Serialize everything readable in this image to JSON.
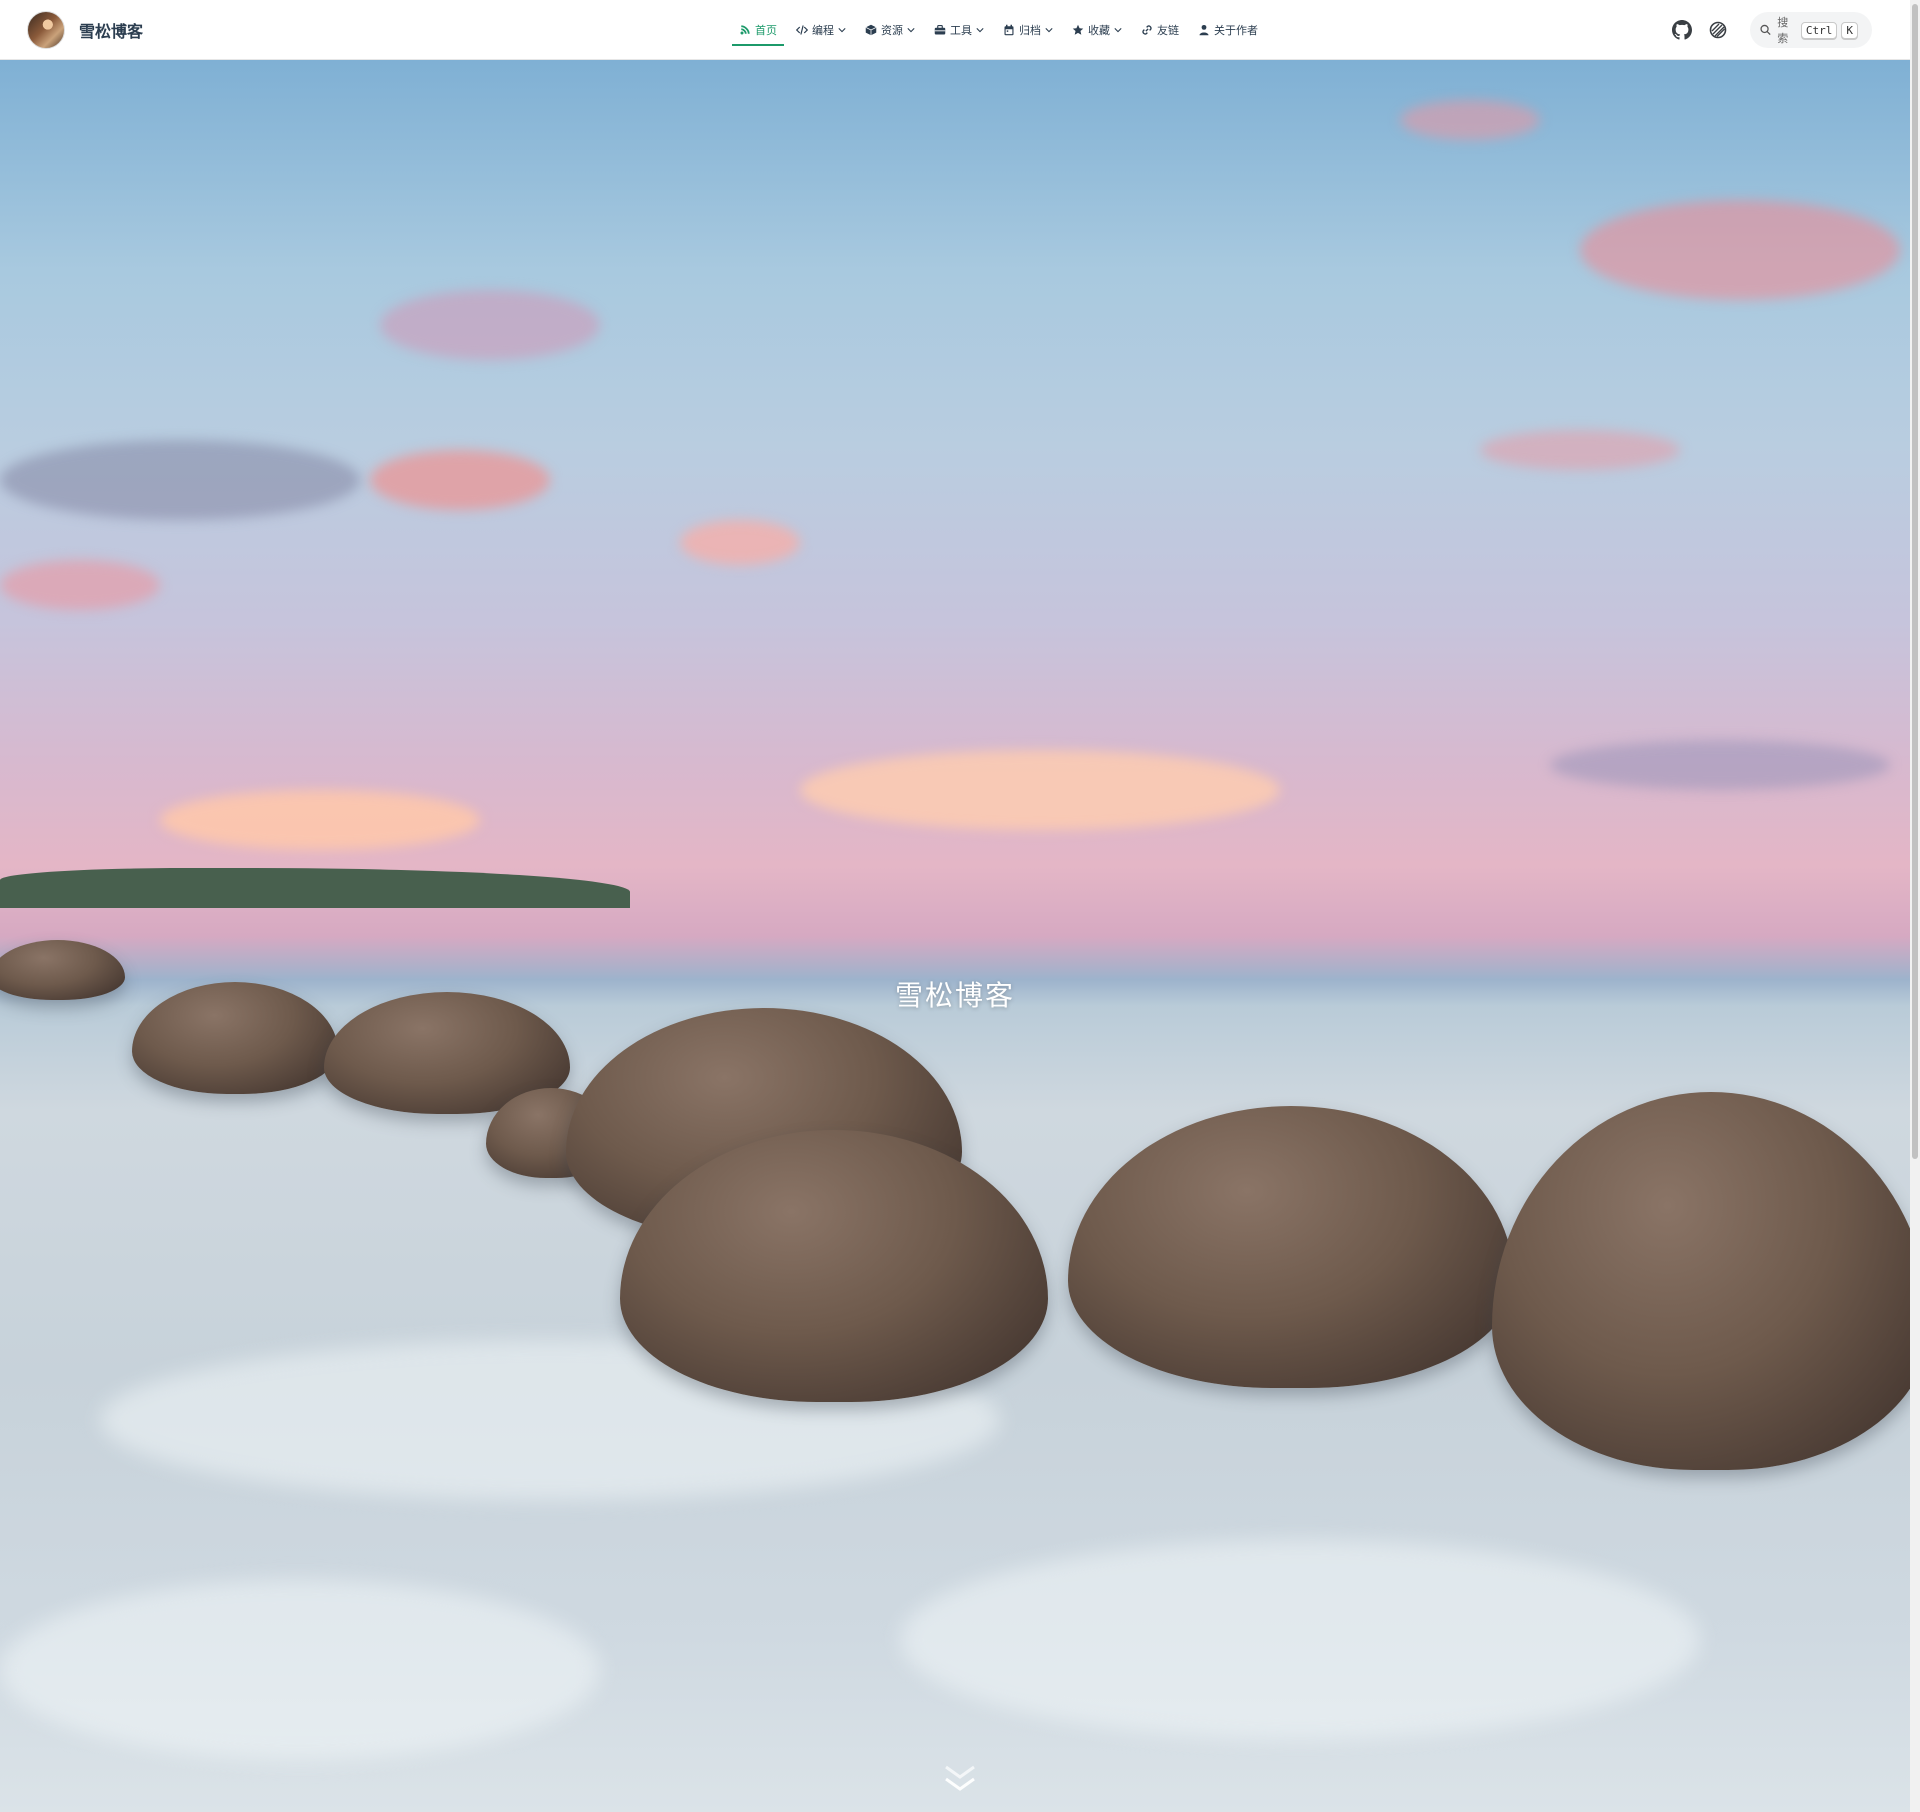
{
  "site": {
    "title": "雪松博客"
  },
  "nav": {
    "items": [
      {
        "label": "首页",
        "icon": "blog-icon",
        "active": true,
        "dropdown": false
      },
      {
        "label": "编程",
        "icon": "code-icon",
        "active": false,
        "dropdown": true
      },
      {
        "label": "资源",
        "icon": "cube-icon",
        "active": false,
        "dropdown": true
      },
      {
        "label": "工具",
        "icon": "toolbox-icon",
        "active": false,
        "dropdown": true
      },
      {
        "label": "归档",
        "icon": "calendar-icon",
        "active": false,
        "dropdown": true
      },
      {
        "label": "收藏",
        "icon": "star-icon",
        "active": false,
        "dropdown": true
      },
      {
        "label": "友链",
        "icon": "link-icon",
        "active": false,
        "dropdown": false
      },
      {
        "label": "关于作者",
        "icon": "user-icon",
        "active": false,
        "dropdown": false
      }
    ]
  },
  "toolbar": {
    "github_icon": "github-icon",
    "theme_icon": "theme-toggle-icon",
    "search_placeholder": "搜索",
    "shortcut_keys": [
      "Ctrl",
      "K"
    ]
  },
  "hero": {
    "title": "雪松博客"
  },
  "colors": {
    "accent": "#1c9a6a",
    "nav_text": "#2c3e50"
  }
}
